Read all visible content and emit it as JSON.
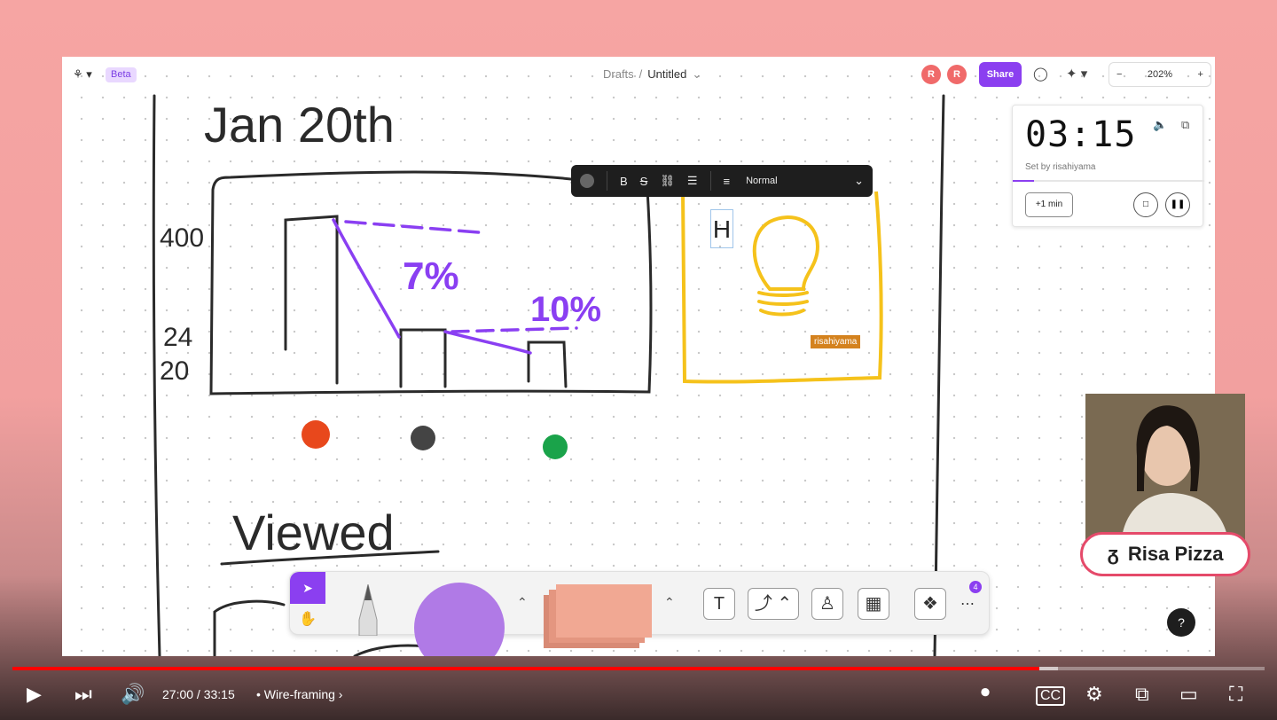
{
  "app": {
    "beta_label": "Beta",
    "breadcrumb_parent": "Drafts",
    "breadcrumb_sep": "/",
    "file_title": "Untitled",
    "avatar_1": "R",
    "avatar_2": "R",
    "share_label": "Share",
    "zoom_minus": "−",
    "zoom_level": "202%",
    "zoom_plus": "+"
  },
  "text_toolbar": {
    "bold": "B",
    "strike": "S",
    "style_value": "Normal"
  },
  "timer": {
    "time": "03:15",
    "set_by": "Set by risahiyama",
    "add_minute_label": "+1 min",
    "progress_fraction": 0.11
  },
  "canvas": {
    "sticky_text": "H",
    "cursor_user": "risahiyama",
    "sketch": {
      "date": "Jan 20th",
      "y_label_top": "400",
      "y_label_mid": "24",
      "y_label_low": "20",
      "pct_1": "7%",
      "pct_2": "10%",
      "heading": "Viewed"
    }
  },
  "toolbar": {
    "text_tool": "T",
    "more_badge": "4"
  },
  "help_label": "?",
  "webcam": {
    "name": "Risa Pizza"
  },
  "player": {
    "time_display": "27:00 / 33:15",
    "chapter_label": "Wire-framing",
    "chapter_bullet": "•",
    "played_fraction": 0.82,
    "buffered_fraction": 0.835
  },
  "colors": {
    "accent": "#8b3ff0",
    "play_red": "#ff0000",
    "sketch_purple": "#8a3ff2",
    "sketch_yellow": "#f5c21b"
  }
}
